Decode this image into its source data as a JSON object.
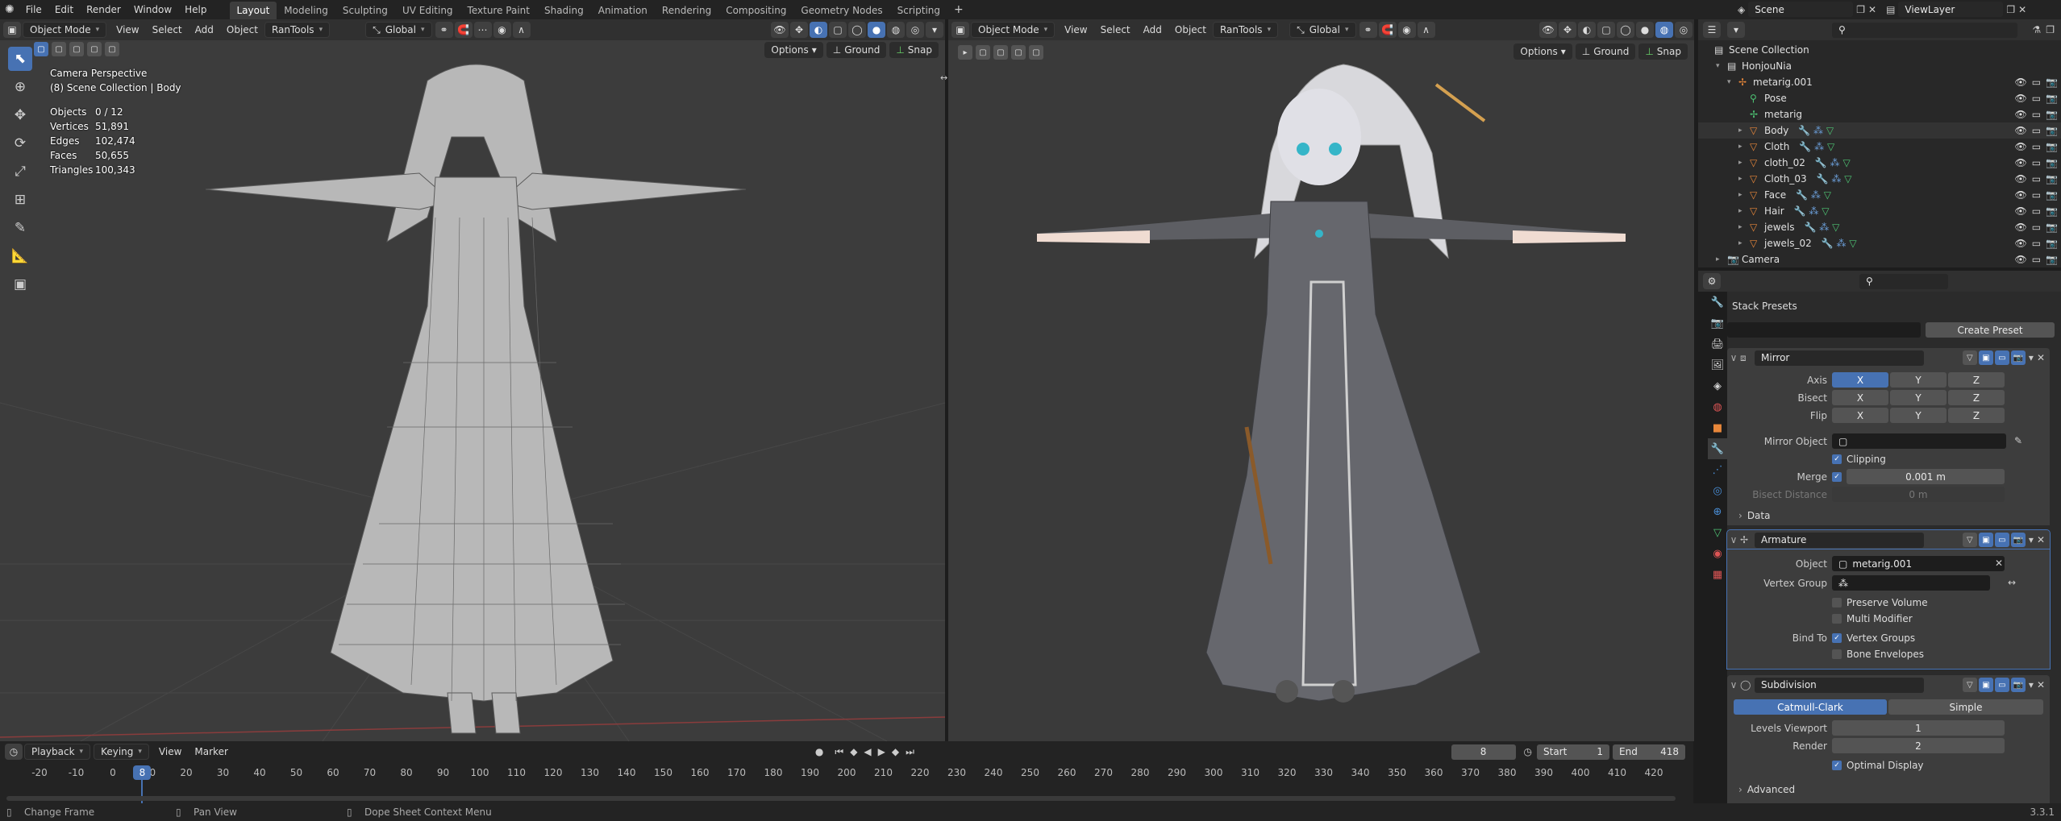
{
  "topbar": {
    "menus": [
      "File",
      "Edit",
      "Render",
      "Window",
      "Help"
    ],
    "workspaces": [
      "Layout",
      "Modeling",
      "Sculpting",
      "UV Editing",
      "Texture Paint",
      "Shading",
      "Animation",
      "Rendering",
      "Compositing",
      "Geometry Nodes",
      "Scripting"
    ],
    "active_workspace": "Layout",
    "scene": "Scene",
    "view_layer": "ViewLayer"
  },
  "viewport_left": {
    "mode": "Object Mode",
    "menus": [
      "View",
      "Select",
      "Add",
      "Object",
      "RanTools"
    ],
    "orientation": "Global",
    "options": "Options",
    "ground": "Ground",
    "snap": "Snap",
    "camera_label": "Camera Perspective",
    "collection_label": "(8) Scene Collection | Body",
    "stats": [
      {
        "label": "Objects",
        "value": "0 / 12"
      },
      {
        "label": "Vertices",
        "value": "51,891"
      },
      {
        "label": "Edges",
        "value": "102,474"
      },
      {
        "label": "Faces",
        "value": "50,655"
      },
      {
        "label": "Triangles",
        "value": "100,343"
      }
    ]
  },
  "viewport_right": {
    "mode": "Object Mode",
    "menus": [
      "View",
      "Select",
      "Add",
      "Object",
      "RanTools"
    ],
    "orientation": "Global",
    "options": "Options",
    "ground": "Ground",
    "snap": "Snap"
  },
  "outliner": {
    "root": "Scene Collection",
    "rows": [
      {
        "name": "HonjouNia",
        "icon": "collection-icon",
        "indent": 1
      },
      {
        "name": "metarig.001",
        "icon": "armature-icon",
        "indent": 2
      },
      {
        "name": "Pose",
        "icon": "pose-icon",
        "indent": 3
      },
      {
        "name": "metarig",
        "icon": "armature-data-icon",
        "indent": 3
      },
      {
        "name": "Body",
        "icon": "mesh-icon",
        "indent": 3
      },
      {
        "name": "Cloth",
        "icon": "mesh-icon",
        "indent": 3
      },
      {
        "name": "cloth_02",
        "icon": "mesh-icon",
        "indent": 3
      },
      {
        "name": "Cloth_03",
        "icon": "mesh-icon",
        "indent": 3
      },
      {
        "name": "Face",
        "icon": "mesh-icon",
        "indent": 3
      },
      {
        "name": "Hair",
        "icon": "mesh-icon",
        "indent": 3
      },
      {
        "name": "jewels",
        "icon": "mesh-icon",
        "indent": 3
      },
      {
        "name": "jewels_02",
        "icon": "mesh-icon",
        "indent": 3
      },
      {
        "name": "Camera",
        "icon": "camera-icon",
        "indent": 1
      }
    ]
  },
  "properties": {
    "stack_presets": "Stack Presets",
    "create_preset": "Create Preset",
    "mirror": {
      "name": "Mirror",
      "axis_label": "Axis",
      "bisect_label": "Bisect",
      "flip_label": "Flip",
      "x": "X",
      "y": "Y",
      "z": "Z",
      "mirror_object_label": "Mirror Object",
      "clipping": "Clipping",
      "merge_label": "Merge",
      "merge_value": "0.001 m",
      "bisect_distance_label": "Bisect Distance",
      "bisect_distance_value": "0 m",
      "data": "Data"
    },
    "armature": {
      "name": "Armature",
      "object_label": "Object",
      "object_value": "metarig.001",
      "vertex_group_label": "Vertex Group",
      "preserve_volume": "Preserve Volume",
      "multi_modifier": "Multi Modifier",
      "bind_to_label": "Bind To",
      "vertex_groups": "Vertex Groups",
      "bone_envelopes": "Bone Envelopes"
    },
    "subdivision": {
      "name": "Subdivision",
      "catmull": "Catmull-Clark",
      "simple": "Simple",
      "levels_viewport_label": "Levels Viewport",
      "levels_viewport_value": "1",
      "render_label": "Render",
      "render_value": "2",
      "optimal_display": "Optimal Display",
      "advanced": "Advanced"
    }
  },
  "timeline": {
    "menus": [
      "Playback",
      "Keying",
      "View",
      "Marker"
    ],
    "current_frame": "8",
    "start_label": "Start",
    "start": "1",
    "end_label": "End",
    "end": "418",
    "ticks": [
      "-20",
      "-10",
      "0",
      "10",
      "20",
      "30",
      "40",
      "50",
      "60",
      "70",
      "80",
      "90",
      "100",
      "110",
      "120",
      "130",
      "140",
      "150",
      "160",
      "170",
      "180",
      "190",
      "200",
      "210",
      "220",
      "230",
      "240",
      "250",
      "260",
      "270",
      "280",
      "290",
      "300",
      "310",
      "320",
      "330",
      "340",
      "350",
      "360",
      "370",
      "380",
      "390",
      "400",
      "410",
      "420"
    ]
  },
  "statusbar": {
    "left": "Change Frame",
    "mid": "Pan View",
    "right": "Dope Sheet Context Menu",
    "version": "3.3.1"
  },
  "colors": {
    "accent": "#4772b3",
    "mesh": "#e8873a",
    "modifier": "#4ec474"
  }
}
